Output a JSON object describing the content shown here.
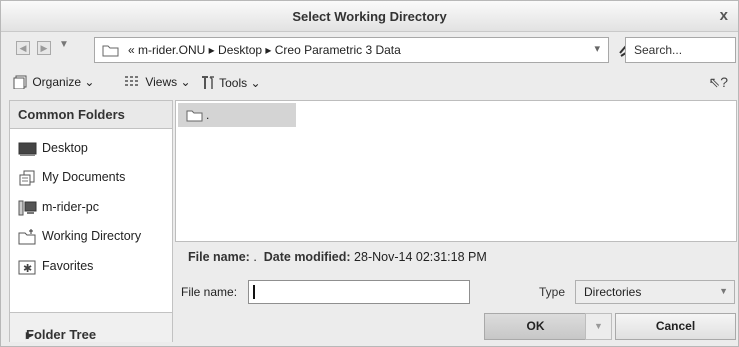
{
  "window": {
    "title": "Select Working Directory",
    "close_glyph": "x"
  },
  "address": {
    "path_text": "« m-rider.ONU ▸ Desktop ▸ Creo Parametric 3 Data",
    "dropdown_glyph": "▾",
    "search_placeholder": "Search..."
  },
  "toolbar": {
    "organize_label": "Organize",
    "views_label": "Views",
    "tools_label": "Tools",
    "help_glyph": "?"
  },
  "common_folders": {
    "header": "Common Folders",
    "items": [
      {
        "label": "Desktop",
        "icon": "desktop-icon"
      },
      {
        "label": "My Documents",
        "icon": "documents-icon"
      },
      {
        "label": "m-rider-pc",
        "icon": "computer-icon"
      },
      {
        "label": "Working Directory",
        "icon": "working-directory-icon"
      },
      {
        "label": "Favorites",
        "icon": "favorites-icon"
      }
    ]
  },
  "folder_tree_label": "Folder Tree",
  "files": [
    {
      "name": "."
    }
  ],
  "info": {
    "name_label": "File name:",
    "name_value": ".",
    "date_label": "Date modified:",
    "date_value": "28-Nov-14 02:31:18 PM"
  },
  "file_name_field": {
    "label": "File name:",
    "value": ""
  },
  "type_field": {
    "label": "Type",
    "value": "Directories"
  },
  "buttons": {
    "ok_label": "OK",
    "cancel_label": "Cancel"
  },
  "colors": {
    "window_bg": "#ececec",
    "selection": "#d4d4d4",
    "border": "#b8b8b8"
  }
}
